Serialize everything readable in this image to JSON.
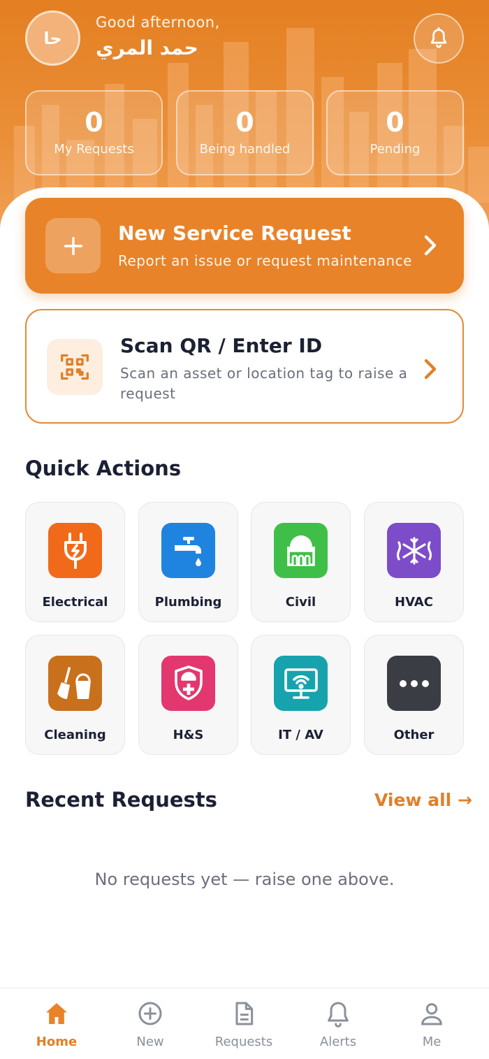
{
  "header": {
    "avatar_initials": "حا",
    "greeting": "Good afternoon,",
    "user_name": "حمد المري"
  },
  "stats": [
    {
      "value": "0",
      "label": "My Requests"
    },
    {
      "value": "0",
      "label": "Being handled"
    },
    {
      "value": "0",
      "label": "Pending"
    }
  ],
  "new_request": {
    "title": "New Service Request",
    "subtitle": "Report an issue or request maintenance"
  },
  "scan": {
    "title": "Scan QR / Enter ID",
    "subtitle": "Scan an asset or location tag to raise a request"
  },
  "quick_actions": {
    "title": "Quick Actions",
    "items": [
      {
        "label": "Electrical",
        "icon": "plug-icon",
        "color": "#f06a1a"
      },
      {
        "label": "Plumbing",
        "icon": "faucet-icon",
        "color": "#1e84e0"
      },
      {
        "label": "Civil",
        "icon": "hard-hat-building-icon",
        "color": "#3fbf48"
      },
      {
        "label": "HVAC",
        "icon": "snowflake-icon",
        "color": "#7d4cc9"
      },
      {
        "label": "Cleaning",
        "icon": "broom-bucket-icon",
        "color": "#c9701c"
      },
      {
        "label": "H&S",
        "icon": "shield-hardhat-icon",
        "color": "#e2376f"
      },
      {
        "label": "IT / AV",
        "icon": "monitor-wifi-icon",
        "color": "#17a3ad"
      },
      {
        "label": "Other",
        "icon": "more-dots-icon",
        "color": "#3b3d45"
      }
    ]
  },
  "recent": {
    "title": "Recent Requests",
    "view_all": "View all →",
    "empty_text": "No requests yet — raise one above."
  },
  "tabs": [
    {
      "label": "Home",
      "icon": "home-icon",
      "active": true
    },
    {
      "label": "New",
      "icon": "plus-circle-icon",
      "active": false
    },
    {
      "label": "Requests",
      "icon": "document-icon",
      "active": false
    },
    {
      "label": "Alerts",
      "icon": "bell-icon",
      "active": false
    },
    {
      "label": "Me",
      "icon": "user-icon",
      "active": false
    }
  ],
  "colors": {
    "accent": "#e8832a",
    "text_dark": "#1c2033",
    "text_muted": "#6b6f7c"
  }
}
